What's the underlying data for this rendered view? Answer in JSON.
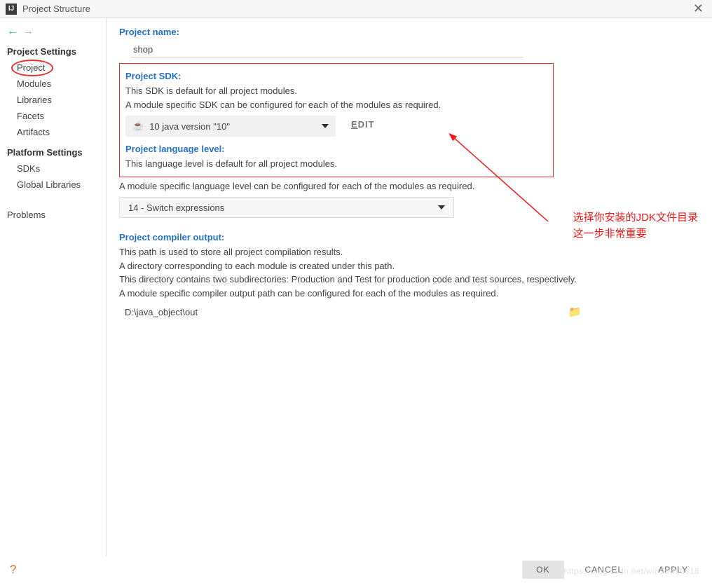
{
  "window": {
    "title": "Project Structure",
    "app_icon_text": "IJ"
  },
  "sidebar": {
    "section_project_settings": "Project Settings",
    "section_platform_settings": "Platform Settings",
    "items_project": [
      "Project",
      "Modules",
      "Libraries",
      "Facets",
      "Artifacts"
    ],
    "items_platform": [
      "SDKs",
      "Global Libraries"
    ],
    "item_problems": "Problems"
  },
  "main": {
    "project_name_label": "Project name:",
    "project_name_value": "shop",
    "project_sdk_label": "Project SDK:",
    "sdk_desc_1": "This SDK is default for all project modules.",
    "sdk_desc_2": "A module specific SDK can be configured for each of the modules as required.",
    "sdk_value": "10 java version \"10\"",
    "edit_label": "EDIT",
    "lang_level_label": "Project language level:",
    "lang_level_desc_1": "This language level is default for all project modules.",
    "lang_level_desc_2": "A module specific language level can be configured for each of the modules as required.",
    "lang_level_value": "14 - Switch expressions",
    "compiler_output_label": "Project compiler output:",
    "compiler_desc_1": "This path is used to store all project compilation results.",
    "compiler_desc_2": "A directory corresponding to each module is created under this path.",
    "compiler_desc_3": "This directory contains two subdirectories: Production and Test for production code and test sources, respectively.",
    "compiler_desc_4": "A module specific compiler output path can be configured for each of the modules as required.",
    "compiler_output_value": "D:\\java_object\\out"
  },
  "annotation": {
    "line1": "选择你安装的JDK文件目录",
    "line2": "这一步非常重要"
  },
  "footer": {
    "ok": "OK",
    "cancel": "CANCEL",
    "apply": "APPLY"
  },
  "watermark": "https://blog.csdn.net/windows0818"
}
